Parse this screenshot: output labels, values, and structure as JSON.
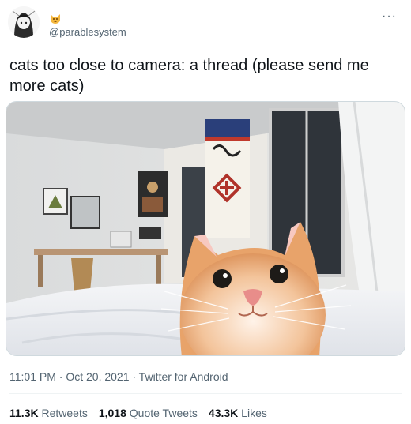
{
  "tweet": {
    "handle": "@parablesystem",
    "more_icon": "more-horizontal-icon",
    "text": "cats too close to camera: a thread (please send me more cats)",
    "timestamp": "11:01 PM · Oct 20, 2021 · Twitter for Android",
    "stats": {
      "retweets_value": "11.3K",
      "retweets_label": "Retweets",
      "quotes_value": "1,018",
      "quotes_label": "Quote Tweets",
      "likes_value": "43.3K",
      "likes_label": "Likes"
    }
  }
}
